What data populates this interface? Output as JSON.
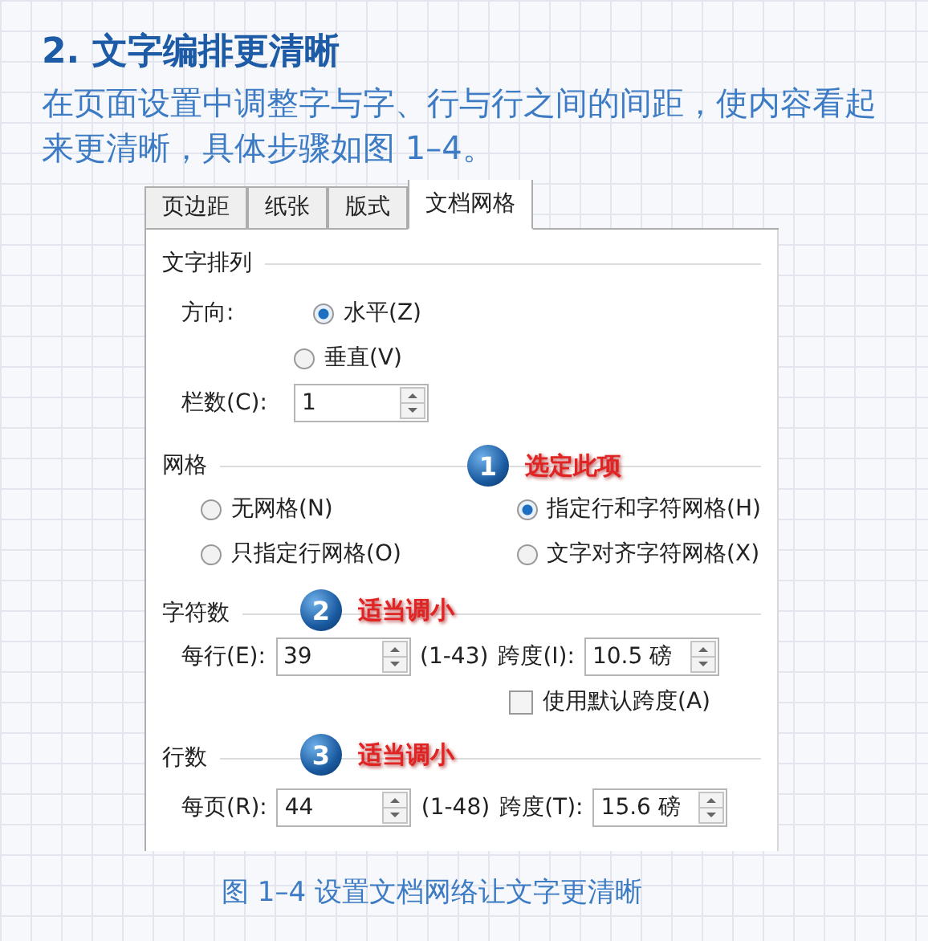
{
  "heading": "2. 文字编排更清晰",
  "intro": "在页面设置中调整字与字、行与行之间的间距，使内容看起来更清晰，具体步骤如图 1–4。",
  "dialog": {
    "tabs": [
      {
        "label": "页边距",
        "selected": false
      },
      {
        "label": "纸张",
        "selected": false
      },
      {
        "label": "版式",
        "selected": false
      },
      {
        "label": "文档网格",
        "selected": true
      }
    ],
    "text_direction": {
      "title": "文字排列",
      "direction_label": "方向:",
      "options": [
        {
          "label": "水平(Z)",
          "selected": true
        },
        {
          "label": "垂直(V)",
          "selected": false
        }
      ],
      "columns": {
        "label": "栏数(C):",
        "value": "1"
      }
    },
    "grid": {
      "title": "网格",
      "callout": {
        "number": "1",
        "note": "选定此项"
      },
      "options": [
        {
          "label": "无网格(N)",
          "selected": false
        },
        {
          "label": "指定行和字符网格(H)",
          "selected": true
        },
        {
          "label": "只指定行网格(O)",
          "selected": false
        },
        {
          "label": "文字对齐字符网格(X)",
          "selected": false
        }
      ]
    },
    "characters": {
      "title": "字符数",
      "callout": {
        "number": "2",
        "note": "适当调小"
      },
      "count": {
        "label": "每行(E):",
        "value": "39",
        "range": "(1-43)"
      },
      "pitch": {
        "label": "跨度(I):",
        "value": "10.5 磅"
      },
      "default_pitch": {
        "label": "使用默认跨度(A)",
        "checked": false
      }
    },
    "lines": {
      "title": "行数",
      "callout": {
        "number": "3",
        "note": "适当调小"
      },
      "count": {
        "label": "每页(R):",
        "value": "44",
        "range": "(1-48)"
      },
      "pitch": {
        "label": "跨度(T):",
        "value": "15.6 磅"
      }
    }
  },
  "caption": "图 1–4 设置文档网络让文字更清晰"
}
